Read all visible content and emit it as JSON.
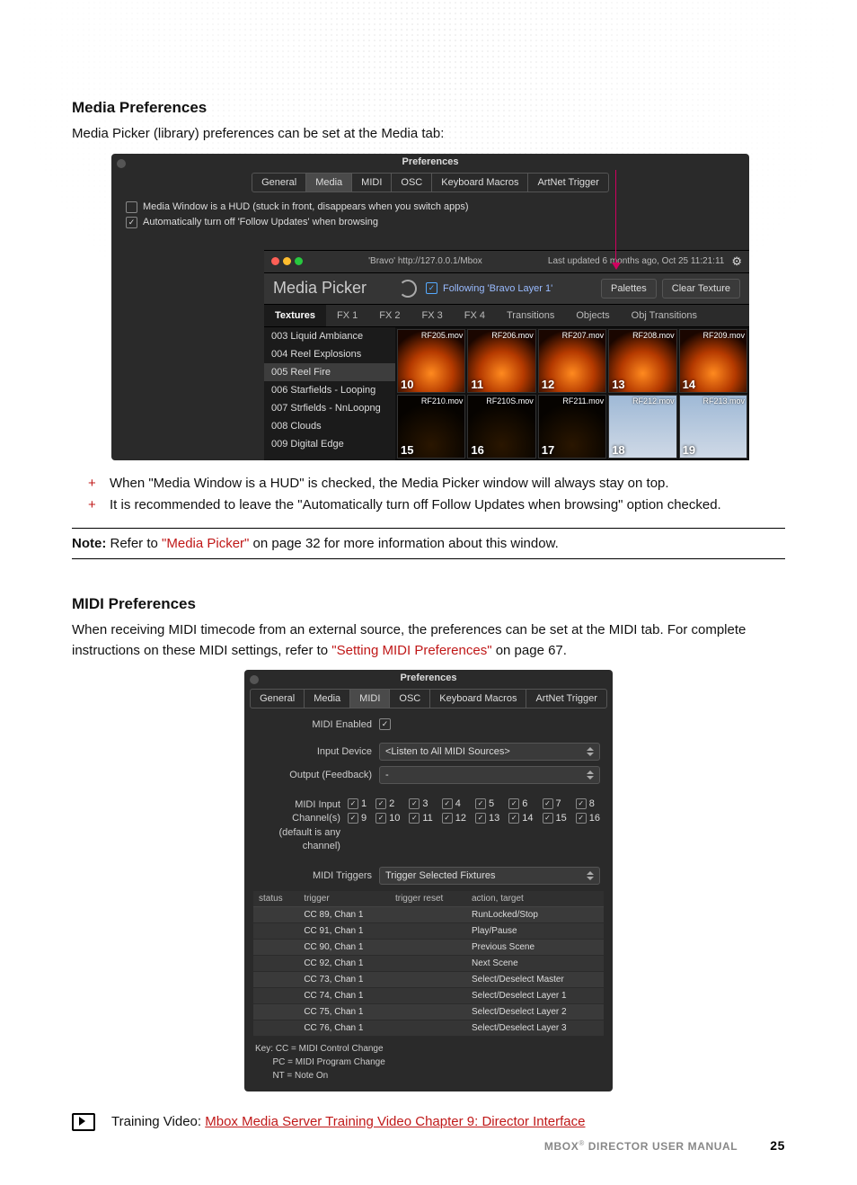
{
  "sectionA": {
    "heading": "Media Preferences",
    "intro": "Media Picker (library) preferences can be set at the Media tab:",
    "bullets": [
      "When \"Media Window is a HUD\" is checked, the Media Picker window will always stay on top.",
      "It is recommended to leave the \"Automatically turn off Follow Updates when browsing\" option checked."
    ],
    "note_prefix": "Note:",
    "note_pre": "  Refer to ",
    "note_link": "\"Media Picker\"",
    "note_post": " on page 32 for more information about this window."
  },
  "prefsA": {
    "title": "Preferences",
    "tabs": [
      "General",
      "Media",
      "MIDI",
      "OSC",
      "Keyboard Macros",
      "ArtNet Trigger"
    ],
    "chk1": "Media Window is a HUD (stuck in front, disappears when you switch apps)",
    "chk2": "Automatically turn off 'Follow Updates' when browsing"
  },
  "mediaPicker": {
    "addr": "'Bravo' http://127.0.0.1/Mbox",
    "updated": "Last updated 6 months ago, Oct 25 11:21:11",
    "title": "Media Picker",
    "follow": "Following 'Bravo Layer 1'",
    "btn_palettes": "Palettes",
    "btn_clear": "Clear Texture",
    "tabs": [
      "Textures",
      "FX 1",
      "FX 2",
      "FX 3",
      "FX 4",
      "Transitions",
      "Objects",
      "Obj Transitions"
    ],
    "sidebar": [
      "003 Liquid Ambiance",
      "004 Reel Explosions",
      "005 Reel Fire",
      "006 Starfields - Looping",
      "007 Strfields - NnLoopng",
      "008 Clouds",
      "009 Digital Edge"
    ],
    "sidebar_selected": 2,
    "thumbs": [
      {
        "fn": "RF205.mov",
        "idx": "10",
        "cls": ""
      },
      {
        "fn": "RF206.mov",
        "idx": "11",
        "cls": ""
      },
      {
        "fn": "RF207.mov",
        "idx": "12",
        "cls": ""
      },
      {
        "fn": "RF208.mov",
        "idx": "13",
        "cls": ""
      },
      {
        "fn": "RF209.mov",
        "idx": "14",
        "cls": ""
      },
      {
        "fn": "RF210.mov",
        "idx": "15",
        "cls": "dark"
      },
      {
        "fn": "RF210S.mov",
        "idx": "16",
        "cls": "dark"
      },
      {
        "fn": "RF211.mov",
        "idx": "17",
        "cls": "dark"
      },
      {
        "fn": "RF212.mov",
        "idx": "18",
        "cls": "sky"
      },
      {
        "fn": "RF213.mov",
        "idx": "19",
        "cls": "sky"
      }
    ]
  },
  "sectionB": {
    "heading": "MIDI Preferences",
    "intro_pre": "When receiving MIDI timecode from an external source, the preferences can be set at the MIDI tab. For complete instructions on these MIDI settings, refer to ",
    "intro_link": "\"Setting MIDI Preferences\"",
    "intro_post": " on page 67."
  },
  "prefsB": {
    "title": "Preferences",
    "tabs": [
      "General",
      "Media",
      "MIDI",
      "OSC",
      "Keyboard Macros",
      "ArtNet Trigger"
    ],
    "midi_enabled": "MIDI Enabled",
    "input_device_lbl": "Input Device",
    "input_device_val": "<Listen to All MIDI Sources>",
    "output_lbl": "Output (Feedback)",
    "output_val": "-",
    "chan_lbl1": "MIDI Input Channel(s)",
    "chan_lbl2": "(default is any channel)",
    "channels": [
      "1",
      "2",
      "3",
      "4",
      "5",
      "6",
      "7",
      "8",
      "9",
      "10",
      "11",
      "12",
      "13",
      "14",
      "15",
      "16"
    ],
    "triggers_lbl": "MIDI Triggers",
    "triggers_val": "Trigger Selected Fixtures",
    "cols": [
      "status",
      "trigger",
      "trigger reset",
      "action, target"
    ],
    "rows": [
      [
        "",
        "CC 89, Chan 1",
        "",
        "RunLocked/Stop"
      ],
      [
        "",
        "CC 91, Chan 1",
        "",
        "Play/Pause"
      ],
      [
        "",
        "CC 90, Chan 1",
        "",
        "Previous Scene"
      ],
      [
        "",
        "CC 92, Chan 1",
        "",
        "Next Scene"
      ],
      [
        "",
        "CC 73, Chan 1",
        "",
        "Select/Deselect Master"
      ],
      [
        "",
        "CC 74, Chan 1",
        "",
        "Select/Deselect Layer 1"
      ],
      [
        "",
        "CC 75, Chan 1",
        "",
        "Select/Deselect Layer 2"
      ],
      [
        "",
        "CC 76, Chan 1",
        "",
        "Select/Deselect Layer 3"
      ]
    ],
    "key1": "Key: CC = MIDI Control Change",
    "key2": "PC = MIDI Program Change",
    "key3": "NT = Note On"
  },
  "video": {
    "label": "Training Video: ",
    "link": "Mbox Media Server Training Video Chapter 9: Director Interface"
  },
  "footer": {
    "product": "MBOX",
    "reg": "®",
    "title": " DIRECTOR USER MANUAL",
    "page": "25"
  }
}
